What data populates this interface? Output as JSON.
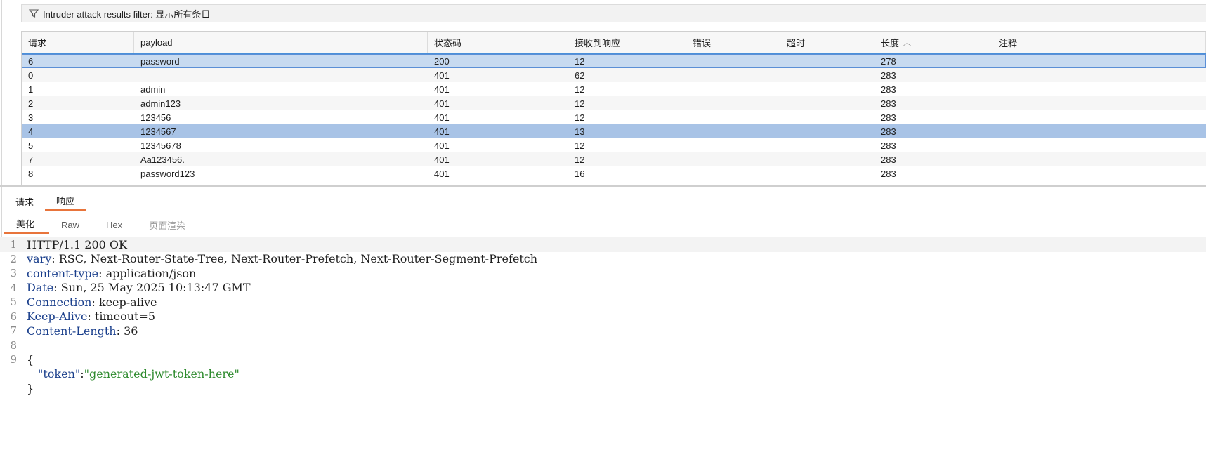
{
  "filter": {
    "label": "Intruder attack results filter: 显示所有条目"
  },
  "table": {
    "columns": [
      "请求",
      "payload",
      "状态码",
      "接收到响应",
      "错误",
      "超时",
      "长度",
      "注释"
    ],
    "sorted_column_index": 6,
    "sort_direction": "ascending",
    "rows": [
      {
        "req": "6",
        "payload": "password",
        "status": "200",
        "resp": "12",
        "err": "",
        "timeout": "",
        "len": "278",
        "note": ""
      },
      {
        "req": "0",
        "payload": "",
        "status": "401",
        "resp": "62",
        "err": "",
        "timeout": "",
        "len": "283",
        "note": ""
      },
      {
        "req": "1",
        "payload": "admin",
        "status": "401",
        "resp": "12",
        "err": "",
        "timeout": "",
        "len": "283",
        "note": ""
      },
      {
        "req": "2",
        "payload": "admin123",
        "status": "401",
        "resp": "12",
        "err": "",
        "timeout": "",
        "len": "283",
        "note": ""
      },
      {
        "req": "3",
        "payload": "123456",
        "status": "401",
        "resp": "12",
        "err": "",
        "timeout": "",
        "len": "283",
        "note": ""
      },
      {
        "req": "4",
        "payload": "1234567",
        "status": "401",
        "resp": "13",
        "err": "",
        "timeout": "",
        "len": "283",
        "note": ""
      },
      {
        "req": "5",
        "payload": "12345678",
        "status": "401",
        "resp": "12",
        "err": "",
        "timeout": "",
        "len": "283",
        "note": ""
      },
      {
        "req": "7",
        "payload": "Aa123456.",
        "status": "401",
        "resp": "12",
        "err": "",
        "timeout": "",
        "len": "283",
        "note": ""
      },
      {
        "req": "8",
        "payload": "password123",
        "status": "401",
        "resp": "16",
        "err": "",
        "timeout": "",
        "len": "283",
        "note": ""
      }
    ]
  },
  "tabs_main": [
    {
      "label": "请求",
      "active": false
    },
    {
      "label": "响应",
      "active": true
    }
  ],
  "tabs_sub": [
    {
      "label": "美化",
      "state": "active"
    },
    {
      "label": "Raw",
      "state": "normal"
    },
    {
      "label": "Hex",
      "state": "normal"
    },
    {
      "label": "页面渲染",
      "state": "disabled"
    }
  ],
  "editor": {
    "lines": [
      {
        "n": "1",
        "key": "",
        "text": "HTTP/1.1 200 OK"
      },
      {
        "n": "2",
        "key": "vary",
        "text": ": RSC, Next-Router-State-Tree, Next-Router-Prefetch, Next-Router-Segment-Prefetch"
      },
      {
        "n": "3",
        "key": "content-type",
        "text": ": application/json"
      },
      {
        "n": "4",
        "key": "Date",
        "text": ": Sun, 25 May 2025 10:13:47 GMT"
      },
      {
        "n": "5",
        "key": "Connection",
        "text": ": keep-alive"
      },
      {
        "n": "6",
        "key": "Keep-Alive",
        "text": ": timeout=5"
      },
      {
        "n": "7",
        "key": "Content-Length",
        "text": ": 36"
      },
      {
        "n": "8",
        "key": "",
        "text": ""
      },
      {
        "n": "9",
        "key": "",
        "text": "{"
      }
    ],
    "json_key": "\"token\"",
    "json_sep": ":",
    "json_value": "\"generated-jwt-token-here\"",
    "close_brace": "}"
  },
  "colors": {
    "accent_tab": "#e8743b",
    "selection_primary": "#a8c3e6",
    "selection_secondary": "#c7daf0",
    "header_key": "#1a3f8c",
    "json_string": "#2e8b2e"
  }
}
